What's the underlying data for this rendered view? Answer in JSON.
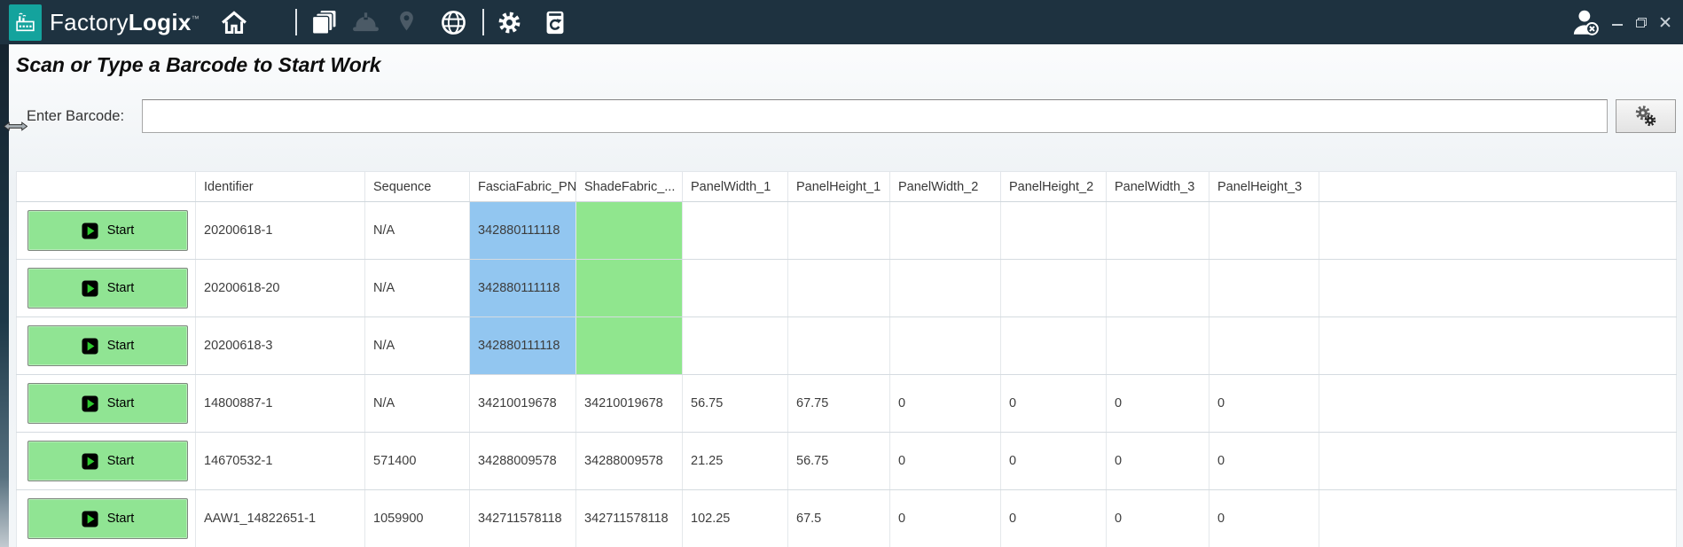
{
  "window": {
    "brand": {
      "factory": "Factory",
      "logix": "Logix",
      "trademark": "™"
    }
  },
  "page": {
    "heading": "Scan or Type a Barcode to Start Work",
    "barcode_label": "Enter Barcode:",
    "barcode_value": ""
  },
  "table": {
    "start_button_label": "Start",
    "columns": [
      "",
      "Identifier",
      "Sequence",
      "FasciaFabric_PN",
      "ShadeFabric_...",
      "PanelWidth_1",
      "PanelHeight_1",
      "PanelWidth_2",
      "PanelHeight_2",
      "PanelWidth_3",
      "PanelHeight_3",
      ""
    ],
    "rows": [
      {
        "identifier": "20200618-1",
        "sequence": "N/A",
        "fascia_fabric_pn": "342880111118",
        "shade_fabric": "",
        "panel_width_1": "",
        "panel_height_1": "",
        "panel_width_2": "",
        "panel_height_2": "",
        "panel_width_3": "",
        "panel_height_3": "",
        "fascia_highlight": true,
        "shade_highlight": true
      },
      {
        "identifier": "20200618-20",
        "sequence": "N/A",
        "fascia_fabric_pn": "342880111118",
        "shade_fabric": "",
        "panel_width_1": "",
        "panel_height_1": "",
        "panel_width_2": "",
        "panel_height_2": "",
        "panel_width_3": "",
        "panel_height_3": "",
        "fascia_highlight": true,
        "shade_highlight": true
      },
      {
        "identifier": "20200618-3",
        "sequence": "N/A",
        "fascia_fabric_pn": "342880111118",
        "shade_fabric": "",
        "panel_width_1": "",
        "panel_height_1": "",
        "panel_width_2": "",
        "panel_height_2": "",
        "panel_width_3": "",
        "panel_height_3": "",
        "fascia_highlight": true,
        "shade_highlight": true
      },
      {
        "identifier": "14800887-1",
        "sequence": "N/A",
        "fascia_fabric_pn": "34210019678",
        "shade_fabric": "34210019678",
        "panel_width_1": "56.75",
        "panel_height_1": "67.75",
        "panel_width_2": "0",
        "panel_height_2": "0",
        "panel_width_3": "0",
        "panel_height_3": "0",
        "fascia_highlight": false,
        "shade_highlight": false
      },
      {
        "identifier": "14670532-1",
        "sequence": "571400",
        "fascia_fabric_pn": "34288009578",
        "shade_fabric": "34288009578",
        "panel_width_1": "21.25",
        "panel_height_1": "56.75",
        "panel_width_2": "0",
        "panel_height_2": "0",
        "panel_width_3": "0",
        "panel_height_3": "0",
        "fascia_highlight": false,
        "shade_highlight": false
      },
      {
        "identifier": "AAW1_14822651-1",
        "sequence": "1059900",
        "fascia_fabric_pn": "342711578118",
        "shade_fabric": "342711578118",
        "panel_width_1": "102.25",
        "panel_height_1": "67.5",
        "panel_width_2": "0",
        "panel_height_2": "0",
        "panel_width_3": "0",
        "panel_height_3": "0",
        "fascia_highlight": false,
        "shade_highlight": false
      }
    ]
  },
  "icons": {
    "toolbar": [
      "factorylogix-logo",
      "home-icon",
      "documents-icon",
      "hardhat-icon",
      "location-pin-icon",
      "globe-icon",
      "settings-gear-icon",
      "device-sync-icon"
    ],
    "titlebar_right": [
      "user-logout-icon",
      "minimize-icon",
      "restore-icon",
      "close-icon"
    ],
    "barcode_button_icon": "gears-icon",
    "row_button_icon": "play-icon",
    "cursor": "horizontal-resize-cursor"
  },
  "colors": {
    "titlebar": "#1e3240",
    "logo_teal": "#14a39d",
    "highlight_blue": "#92c6f0",
    "highlight_green": "#90e68e",
    "start_button_green": "#90e493"
  }
}
